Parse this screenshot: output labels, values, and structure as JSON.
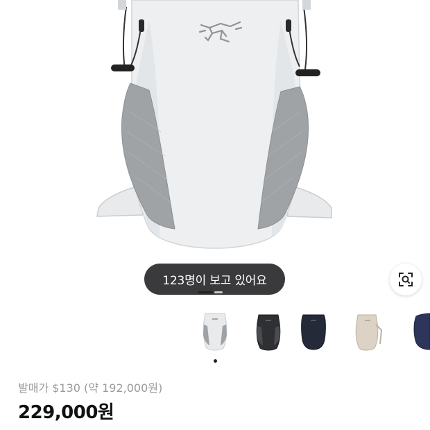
{
  "viewers_badge": "123명이 보고 있어요",
  "retail_price": "발매가 $130 (약 192,000원)",
  "price": "229,000원",
  "carousel": {
    "active_index": 1,
    "total_segments": 2
  },
  "color_options": [
    {
      "name": "white",
      "color": "#dfe3e6",
      "selected": true
    },
    {
      "name": "black",
      "color": "#2b2c2f",
      "selected": false
    },
    {
      "name": "navy",
      "color": "#252a38",
      "selected": false
    },
    {
      "name": "beige",
      "color": "#d9d0c3",
      "selected": false
    },
    {
      "name": "blue",
      "color": "#2d3458",
      "selected": false
    }
  ],
  "icons": {
    "lens": "lens-search-icon",
    "brand": "arcteryx-logo"
  },
  "colors": {
    "pill_bg": "#3a3a3c",
    "price_text": "#111111",
    "muted_text": "#9a9a9a"
  }
}
